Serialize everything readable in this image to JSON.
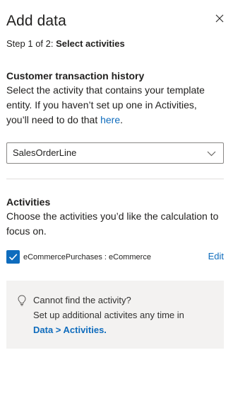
{
  "header": {
    "title": "Add data",
    "close_icon": "close-icon"
  },
  "step": {
    "prefix": "Step 1 of 2:",
    "name": "Select activities"
  },
  "customer_section": {
    "heading": "Customer transaction history",
    "description_line1": "Select the activity that contains your template",
    "description_line2": "entity. If you haven’t set up one in Activities,",
    "description_line3_pre": "you’ll need to do that ",
    "description_link": "here",
    "description_line3_post": ".",
    "dropdown_value": "SalesOrderLine",
    "dropdown_icon": "chevron-down-icon"
  },
  "activities_section": {
    "heading": "Activities",
    "description_line1": "Choose the activities you’d like the calculation to",
    "description_line2": "focus on.",
    "items": [
      {
        "label": "eCommercePurchases : eCommerce",
        "checked": true,
        "edit_label": "Edit"
      }
    ]
  },
  "info_box": {
    "icon": "lightbulb-icon",
    "line1": "Cannot find the activity?",
    "line2": "Set up additional activites any time in",
    "link": "Data > Activities."
  },
  "colors": {
    "accent": "#0f6cbd",
    "info_background": "#f3f2f1",
    "divider": "#e1dfdd",
    "text": "#201f1e"
  }
}
